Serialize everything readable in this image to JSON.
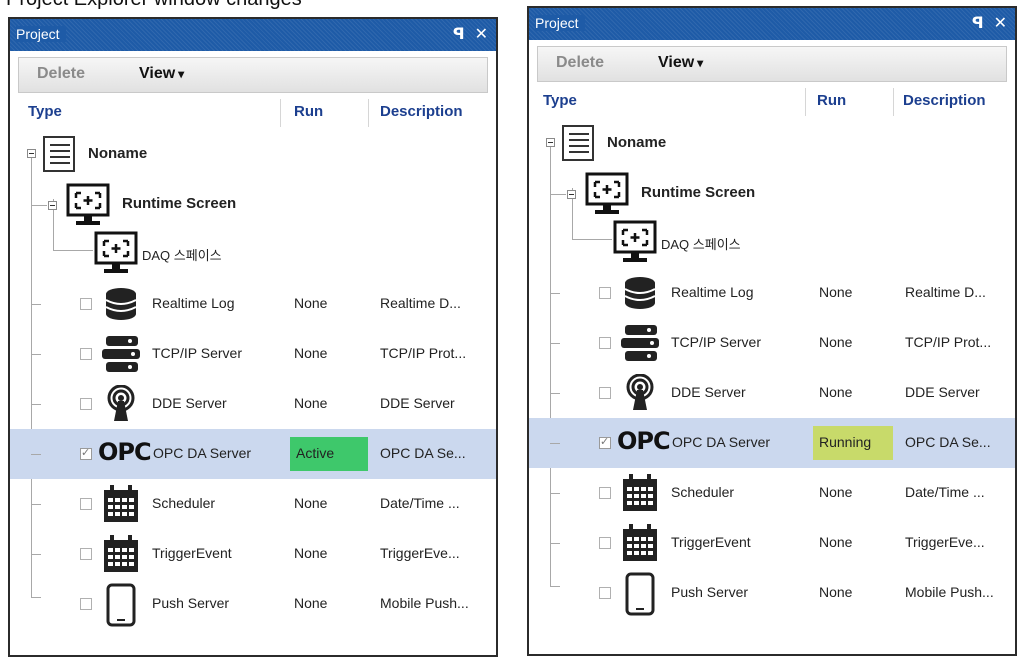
{
  "caption": "Project Explorer window changes",
  "panels": [
    {
      "title": "Project",
      "pin_icon": "pin-icon",
      "close_icon": "close-icon",
      "toolbar": {
        "delete_label": "Delete",
        "view_label": "View"
      },
      "headers": {
        "type": "Type",
        "run": "Run",
        "description": "Description"
      },
      "root": {
        "label": "Noname"
      },
      "screen": {
        "label": "Runtime Screen"
      },
      "daq": {
        "label": "DAQ 스페이스"
      },
      "items": [
        {
          "label": "Realtime Log",
          "run": "None",
          "description": "Realtime D...",
          "icon": "database-icon",
          "checked": false
        },
        {
          "label": "TCP/IP Server",
          "run": "None",
          "description": "TCP/IP Prot...",
          "icon": "server-icon",
          "checked": false
        },
        {
          "label": "DDE Server",
          "run": "None",
          "description": "DDE Server",
          "icon": "antenna-icon",
          "checked": false
        },
        {
          "label": "OPC DA Server",
          "run": "Active",
          "description": "OPC DA Se...",
          "icon": "opc-logo-icon",
          "checked": true
        },
        {
          "label": "Scheduler",
          "run": "None",
          "description": "Date/Time ...",
          "icon": "calendar-icon",
          "checked": false
        },
        {
          "label": "TriggerEvent",
          "run": "None",
          "description": "TriggerEve...",
          "icon": "calendar-icon",
          "checked": false
        },
        {
          "label": "Push Server",
          "run": "None",
          "description": "Mobile Push...",
          "icon": "phone-icon",
          "checked": false
        }
      ],
      "status_color": "#3ec86b",
      "selection_color": "#cbd8ee"
    },
    {
      "title": "Project",
      "pin_icon": "pin-icon",
      "close_icon": "close-icon",
      "toolbar": {
        "delete_label": "Delete",
        "view_label": "View"
      },
      "headers": {
        "type": "Type",
        "run": "Run",
        "description": "Description"
      },
      "root": {
        "label": "Noname"
      },
      "screen": {
        "label": "Runtime Screen"
      },
      "daq": {
        "label": "DAQ 스페이스"
      },
      "items": [
        {
          "label": "Realtime Log",
          "run": "None",
          "description": "Realtime D...",
          "icon": "database-icon",
          "checked": false
        },
        {
          "label": "TCP/IP Server",
          "run": "None",
          "description": "TCP/IP Prot...",
          "icon": "server-icon",
          "checked": false
        },
        {
          "label": "DDE Server",
          "run": "None",
          "description": "DDE Server",
          "icon": "antenna-icon",
          "checked": false
        },
        {
          "label": "OPC DA Server",
          "run": "Running",
          "description": "OPC DA Se...",
          "icon": "opc-logo-icon",
          "checked": true
        },
        {
          "label": "Scheduler",
          "run": "None",
          "description": "Date/Time ...",
          "icon": "calendar-icon",
          "checked": false
        },
        {
          "label": "TriggerEvent",
          "run": "None",
          "description": "TriggerEve...",
          "icon": "calendar-icon",
          "checked": false
        },
        {
          "label": "Push Server",
          "run": "None",
          "description": "Mobile Push...",
          "icon": "phone-icon",
          "checked": false
        }
      ],
      "status_color": "#c8da6a",
      "selection_color": "#cbd8ee"
    }
  ]
}
